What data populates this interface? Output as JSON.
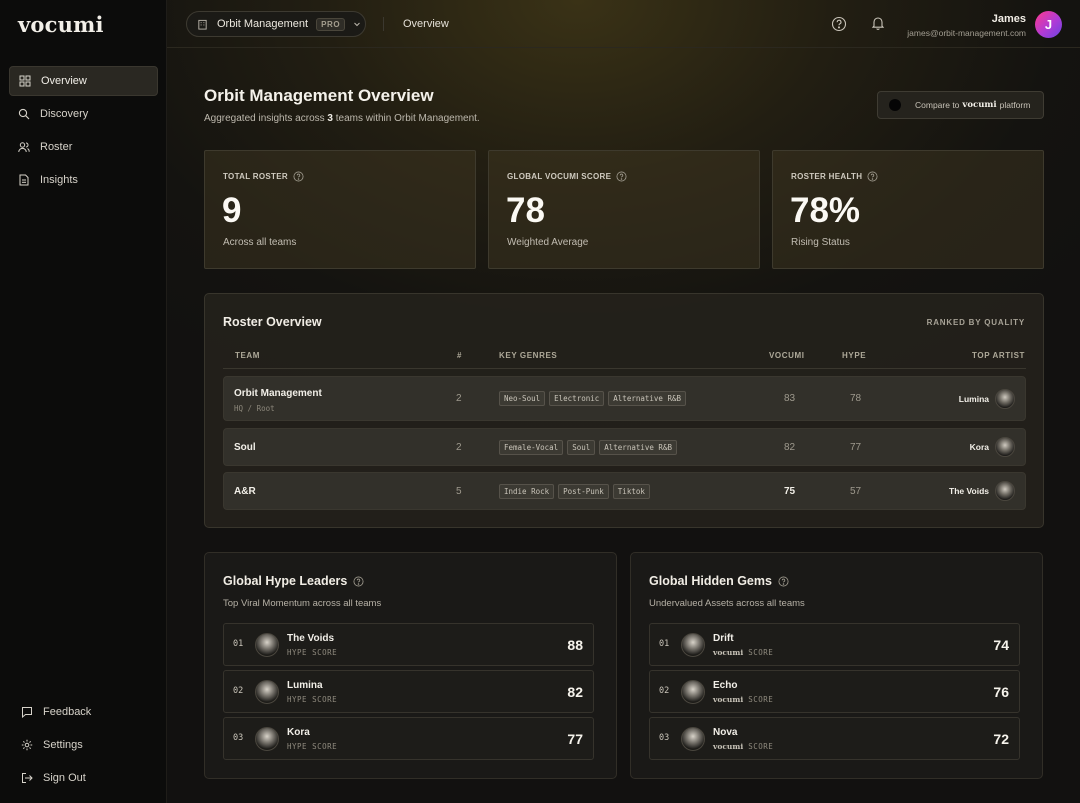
{
  "app": {
    "logo": "vocumi"
  },
  "sidebar": {
    "items": [
      {
        "label": "Overview",
        "icon": "grid-icon",
        "active": true
      },
      {
        "label": "Discovery",
        "icon": "search-icon"
      },
      {
        "label": "Roster",
        "icon": "users-icon"
      },
      {
        "label": "Insights",
        "icon": "document-icon"
      }
    ],
    "bottom": [
      {
        "label": "Feedback",
        "icon": "chat-icon"
      },
      {
        "label": "Settings",
        "icon": "gear-icon"
      },
      {
        "label": "Sign Out",
        "icon": "sign-out-icon"
      }
    ]
  },
  "topbar": {
    "org_name": "Orbit Management",
    "plan_badge": "PRO",
    "breadcrumb": "Overview",
    "user_name": "James",
    "user_email": "james@orbit-management.com",
    "avatar_initial": "J"
  },
  "header": {
    "title": "Orbit Management Overview",
    "subtitle_pre": "Aggregated insights across ",
    "subtitle_count": "3",
    "subtitle_post": " teams within Orbit Management.",
    "compare_pre": "Compare to",
    "compare_brand": "vocumi",
    "compare_post": "platform"
  },
  "stats": [
    {
      "label": "TOTAL ROSTER",
      "value": "9",
      "note": "Across all teams"
    },
    {
      "label": "GLOBAL VOCUMI SCORE",
      "value": "78",
      "note": "Weighted Average"
    },
    {
      "label": "ROSTER HEALTH",
      "value": "78%",
      "note": "Rising Status"
    }
  ],
  "roster": {
    "title": "Roster Overview",
    "ranked_label": "RANKED BY QUALITY",
    "headers": {
      "team": "TEAM",
      "count": "#",
      "genres": "KEY GENRES",
      "vocumi": "VOCUMI",
      "hype": "HYPE",
      "top_artist": "TOP ARTIST"
    },
    "rows": [
      {
        "team": "Orbit Management",
        "sub": "HQ / Root",
        "count": "2",
        "genres": [
          "Neo-Soul",
          "Electronic",
          "Alternative R&B"
        ],
        "vocumi": "83",
        "hype": "78",
        "top_artist": "Lumina"
      },
      {
        "team": "Soul",
        "sub": "",
        "count": "2",
        "genres": [
          "Female-Vocal",
          "Soul",
          "Alternative R&B"
        ],
        "vocumi": "82",
        "hype": "77",
        "top_artist": "Kora"
      },
      {
        "team": "A&R",
        "sub": "",
        "count": "5",
        "genres": [
          "Indie Rock",
          "Post-Punk",
          "Tiktok"
        ],
        "vocumi": "75",
        "hype": "57",
        "top_artist": "The Voids"
      }
    ]
  },
  "hype_leaders": {
    "title": "Global Hype Leaders",
    "subtitle": "Top Viral Momentum across all teams",
    "score_label": "HYPE SCORE",
    "items": [
      {
        "rank": "01",
        "name": "The Voids",
        "value": "88"
      },
      {
        "rank": "02",
        "name": "Lumina",
        "value": "82"
      },
      {
        "rank": "03",
        "name": "Kora",
        "value": "77"
      }
    ]
  },
  "hidden_gems": {
    "title": "Global Hidden Gems",
    "subtitle": "Undervalued Assets across all teams",
    "score_brand": "vocumi",
    "score_label": "SCORE",
    "items": [
      {
        "rank": "01",
        "name": "Drift",
        "value": "74"
      },
      {
        "rank": "02",
        "name": "Echo",
        "value": "76"
      },
      {
        "rank": "03",
        "name": "Nova",
        "value": "72"
      }
    ]
  }
}
